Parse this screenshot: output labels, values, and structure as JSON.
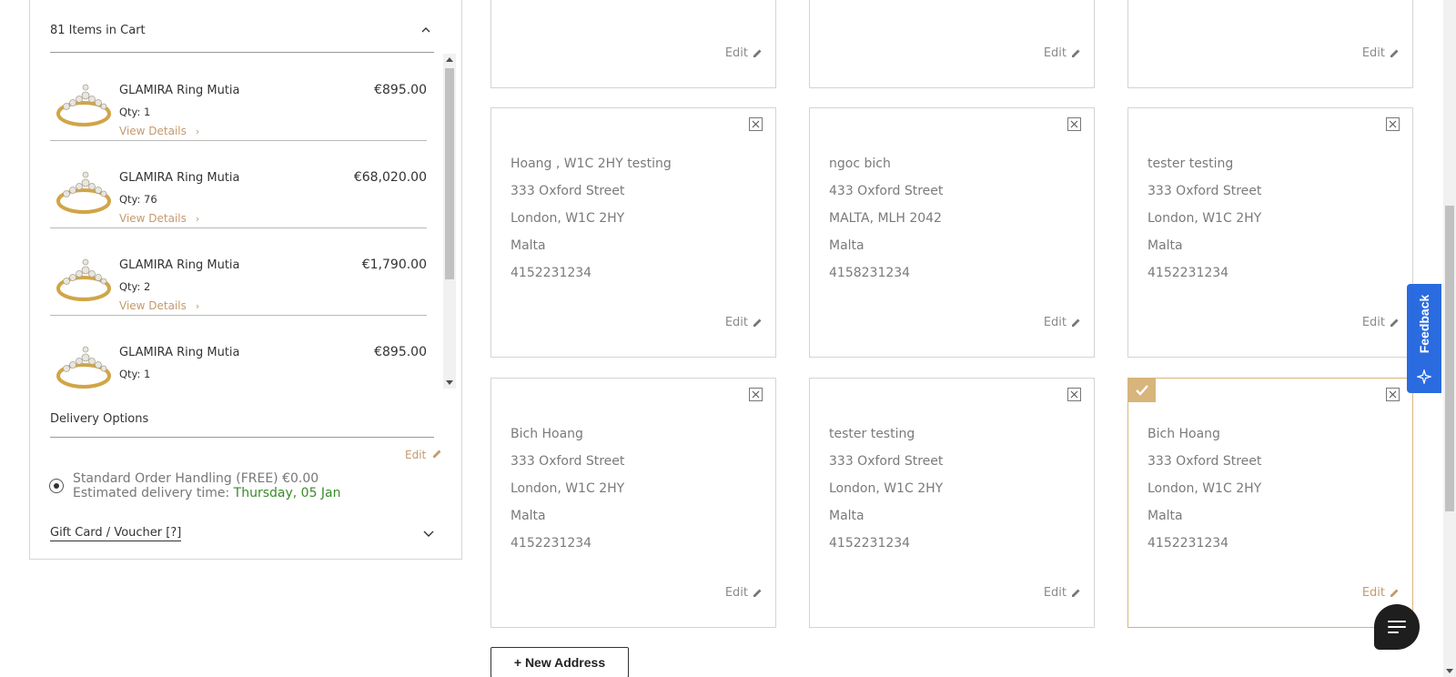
{
  "cart": {
    "header": "81 Items in Cart",
    "items": [
      {
        "name": "GLAMIRA Ring Mutia",
        "price": "€895.00",
        "qty": "Qty: 1",
        "details": "View Details"
      },
      {
        "name": "GLAMIRA Ring Mutia",
        "price": "€68,020.00",
        "qty": "Qty: 76",
        "details": "View Details"
      },
      {
        "name": "GLAMIRA Ring Mutia",
        "price": "€1,790.00",
        "qty": "Qty: 2",
        "details": "View Details"
      },
      {
        "name": "GLAMIRA Ring Mutia",
        "price": "€895.00",
        "qty": "Qty: 1",
        "details": "View Details"
      }
    ]
  },
  "delivery": {
    "header": "Delivery Options",
    "edit": "Edit",
    "option": "Standard Order Handling (FREE) €0.00",
    "estimate_label": "Estimated delivery time:",
    "estimate_date": "Thursday, 05 Jan",
    "gift": "Gift Card / Voucher [?]"
  },
  "addresses": [
    {
      "lines": [],
      "edit": "Edit",
      "selected": false
    },
    {
      "lines": [],
      "edit": "Edit",
      "selected": false
    },
    {
      "lines": [],
      "edit": "Edit",
      "selected": false
    },
    {
      "lines": [
        "Hoang , W1C 2HY testing",
        "333 Oxford Street",
        "London, W1C 2HY",
        "Malta",
        "4152231234"
      ],
      "edit": "Edit",
      "selected": false
    },
    {
      "lines": [
        "ngoc bich",
        "433 Oxford Street",
        "MALTA, MLH 2042",
        "Malta",
        "4158231234"
      ],
      "edit": "Edit",
      "selected": false
    },
    {
      "lines": [
        "tester testing",
        "333 Oxford Street",
        "London, W1C 2HY",
        "Malta",
        "4152231234"
      ],
      "edit": "Edit",
      "selected": false
    },
    {
      "lines": [
        "Bich Hoang",
        "333 Oxford Street",
        "London, W1C 2HY",
        "Malta",
        "4152231234"
      ],
      "edit": "Edit",
      "selected": false
    },
    {
      "lines": [
        "tester testing",
        "333 Oxford Street",
        "London, W1C 2HY",
        "Malta",
        "4152231234"
      ],
      "edit": "Edit",
      "selected": false
    },
    {
      "lines": [
        "Bich Hoang",
        "333 Oxford Street",
        "London, W1C 2HY",
        "Malta",
        "4152231234"
      ],
      "edit": "Edit",
      "selected": true
    }
  ],
  "new_address": "+ New Address",
  "feedback": "Feedback",
  "colors": {
    "accent": "#c49a6c",
    "selected_border": "#d7b57b",
    "feedback_blue": "#2a6be0",
    "date_green": "#3a8a2a"
  }
}
